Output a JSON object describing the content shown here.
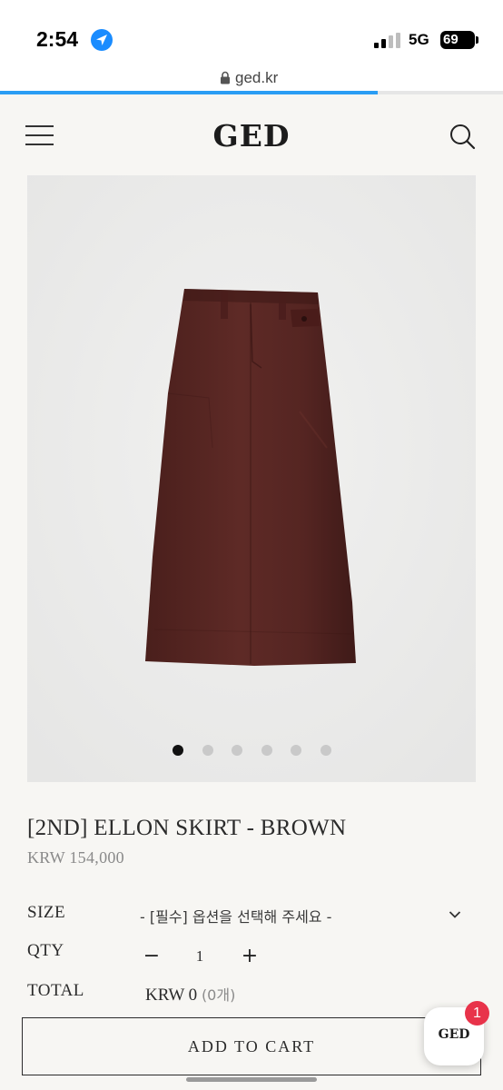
{
  "status_bar": {
    "time": "2:54",
    "network": "5G",
    "battery": "69",
    "location_icon": "location-arrow-icon",
    "accent_color": "#1a8cff"
  },
  "browser": {
    "url": "ged.kr",
    "lock_icon": "lock-icon",
    "load_progress": 0.75,
    "progress_color": "#2a9df4"
  },
  "header": {
    "logo": "GED",
    "menu_icon": "hamburger-menu-icon",
    "search_icon": "search-icon"
  },
  "gallery": {
    "image": "brown long pencil skirt product photo",
    "slide_count": 6,
    "active_index": 0
  },
  "product": {
    "title": "[2ND] ELLON SKIRT - BROWN",
    "price": "KRW 154,000"
  },
  "options": {
    "size_label": "SIZE",
    "size_placeholder": "- [필수] 옵션을 선택해 주세요 -",
    "qty_label": "QTY",
    "qty_minus": "−",
    "qty_value": "1",
    "qty_plus": "+",
    "total_label": "TOTAL",
    "total_value": "KRW 0",
    "total_count": "(0개)"
  },
  "cart": {
    "add_to_cart": "ADD TO CART"
  },
  "chat": {
    "label": "GED",
    "badge": "1",
    "badge_color": "#e8334a"
  }
}
